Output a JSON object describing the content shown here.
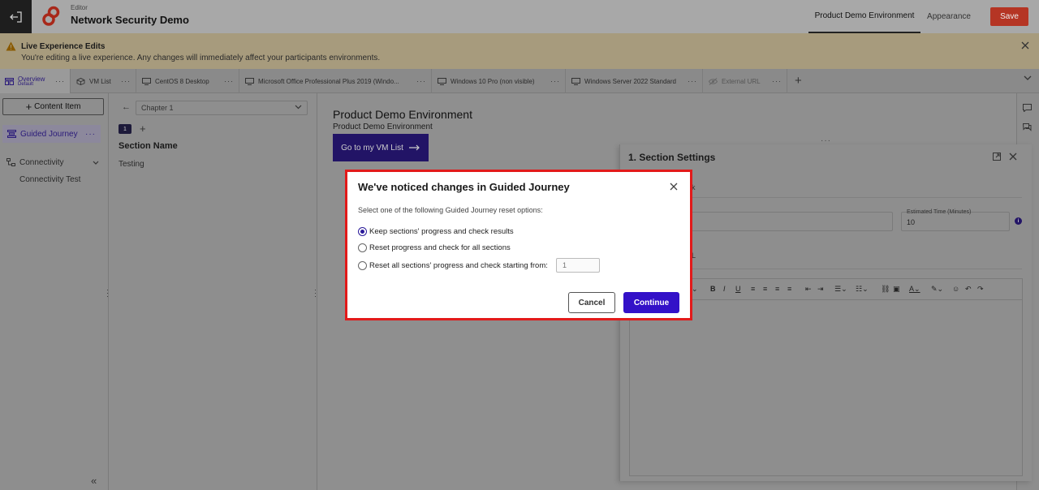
{
  "header": {
    "editor_label": "Editor",
    "project_title": "Network Security Demo",
    "tabs": [
      {
        "label": "Product Demo Environment",
        "active": true
      },
      {
        "label": "Appearance",
        "active": false
      }
    ],
    "save_label": "Save"
  },
  "banner": {
    "title": "Live Experience Edits",
    "text": "You're editing a live experience. Any changes will immediately affect your participants environments."
  },
  "resource_tabs": [
    {
      "label": "Overview",
      "sub": "Default",
      "icon": "overview-icon",
      "active": true
    },
    {
      "label": "VM List",
      "icon": "cube-icon"
    },
    {
      "label": "CentOS 8 Desktop",
      "icon": "monitor-icon"
    },
    {
      "label": "Microsoft Office Professional Plus 2019 (Windo...",
      "icon": "monitor-icon"
    },
    {
      "label": "Windows 10 Pro (non visible)",
      "icon": "monitor-icon"
    },
    {
      "label": "Windows Server 2022 Standard",
      "icon": "monitor-icon"
    },
    {
      "label": "External URL",
      "icon": "eye-off-icon"
    }
  ],
  "sidebar": {
    "content_item_label": "Content Item",
    "items": [
      {
        "label": "Guided Journey",
        "selected": true
      },
      {
        "label": "Connectivity",
        "children": [
          "Connectivity Test"
        ]
      }
    ]
  },
  "chapter_panel": {
    "chapter_value": "Chapter 1",
    "section_badge": "1",
    "section_name_header": "Section Name",
    "sections": [
      "Testing"
    ]
  },
  "main": {
    "title": "Product Demo Environment",
    "subtitle": "Product Demo Environment",
    "button_label": "Go to my VM List"
  },
  "settings": {
    "title": "1. Section Settings",
    "frag_k": "k",
    "frag_l": "L",
    "time_label": "Estimated Time (Minutes)",
    "time_value": "10",
    "info": "i"
  },
  "modal": {
    "title": "We've noticed changes in Guided Journey",
    "instruction": "Select one of the following Guided Journey reset options:",
    "options": [
      {
        "label": "Keep sections' progress and check results",
        "selected": true
      },
      {
        "label": "Reset progress and check for all sections",
        "selected": false
      },
      {
        "label": "Reset all sections' progress and check starting from:",
        "selected": false
      }
    ],
    "from_placeholder": "1",
    "cancel_label": "Cancel",
    "continue_label": "Continue"
  },
  "colors": {
    "accent": "#3311c8",
    "save": "#b53524",
    "modal_border": "#e21a1a"
  }
}
